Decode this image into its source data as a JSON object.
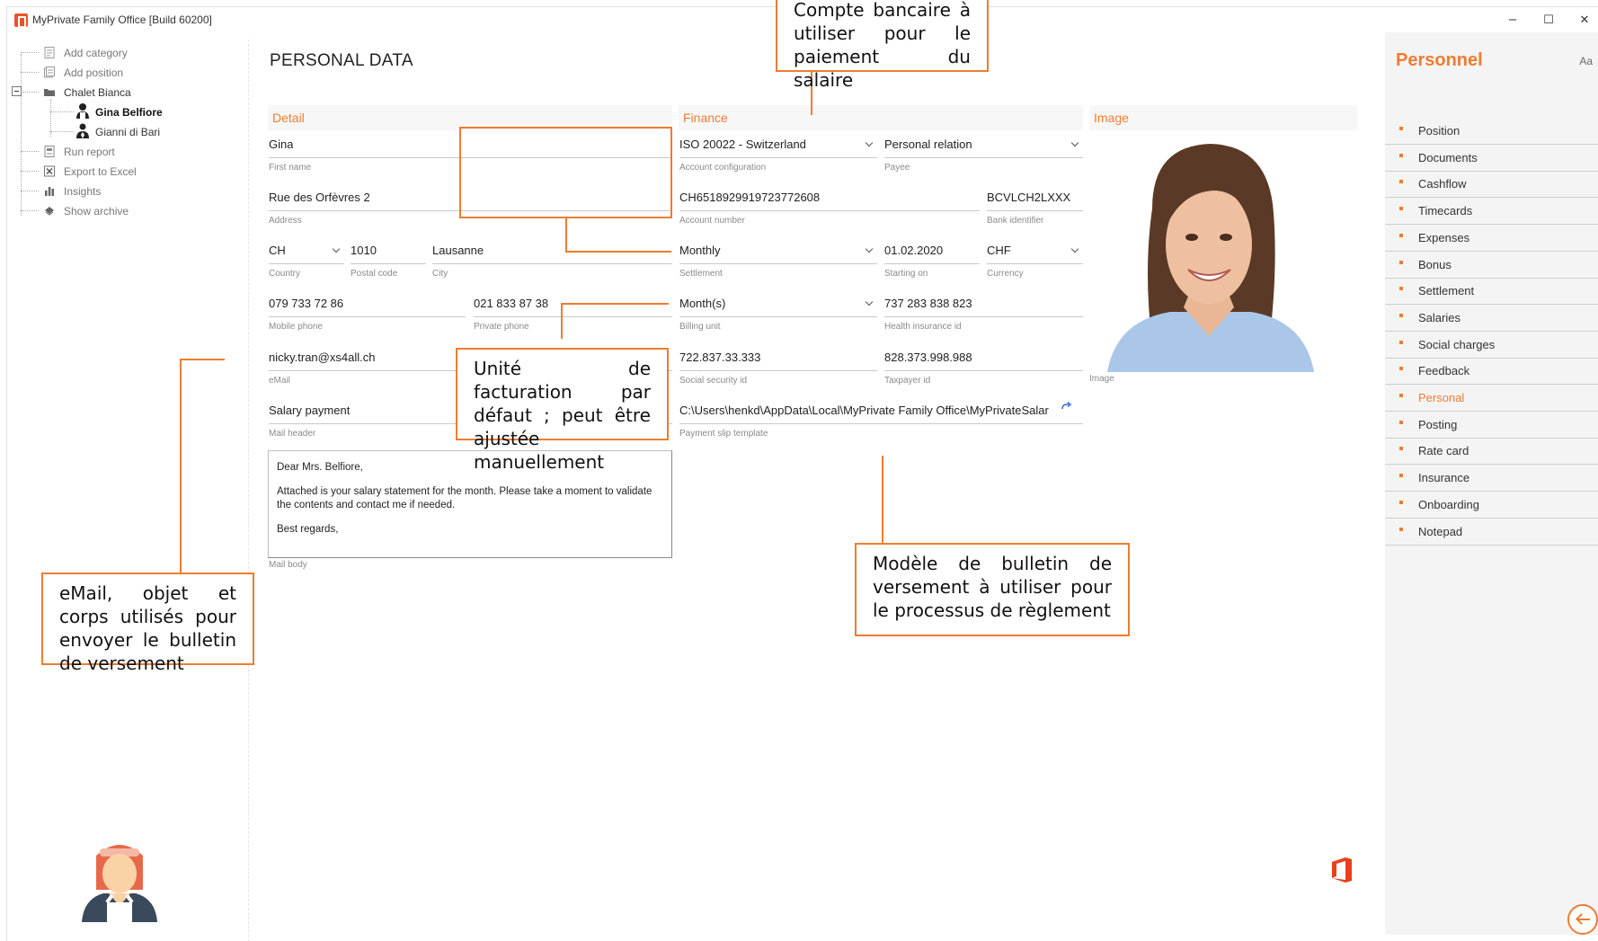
{
  "window": {
    "title": "MyPrivate Family Office [Build 60200]",
    "min_glyph": "–",
    "max_glyph": "☐",
    "close_glyph": "✕"
  },
  "tree": {
    "items": [
      {
        "label": "Add category",
        "icon": "add-category-icon"
      },
      {
        "label": "Add position",
        "icon": "add-position-icon"
      },
      {
        "label": "Chalet Bianca",
        "icon": "folder-icon"
      },
      {
        "label": "Gina Belfiore",
        "icon": "maid-person-icon"
      },
      {
        "label": "Gianni di Bari",
        "icon": "butler-person-icon"
      },
      {
        "label": "Run report",
        "icon": "report-icon"
      },
      {
        "label": "Export to Excel",
        "icon": "excel-icon"
      },
      {
        "label": "Insights",
        "icon": "bar-chart-icon"
      },
      {
        "label": "Show archive",
        "icon": "archive-icon"
      }
    ]
  },
  "page": {
    "title": "PERSONAL DATA"
  },
  "sections": {
    "detail": "Detail",
    "finance": "Finance",
    "image": "Image"
  },
  "detail": {
    "first_name": {
      "value": "Gina",
      "label": "First name"
    },
    "address": {
      "value": "Rue des Orfèvres 2",
      "label": "Address"
    },
    "country": {
      "value": "CH",
      "label": "Country"
    },
    "postal_code": {
      "value": "1010",
      "label": "Postal code"
    },
    "city": {
      "value": "Lausanne",
      "label": "City"
    },
    "mobile_phone": {
      "value": "079 733 72 86",
      "label": "Mobile phone"
    },
    "private_phone": {
      "value": "021 833 87 38",
      "label": "Private phone"
    },
    "email": {
      "value": "nicky.tran@xs4all.ch",
      "label": "eMail"
    },
    "mail_header": {
      "value": "Salary payment",
      "label": "Mail header"
    },
    "mail_body": {
      "greeting": "Dear Mrs. Belfiore,",
      "text": "Attached is your salary statement for the month. Please take a moment to validate the contents and contact me if needed.",
      "closing": "Best regards,",
      "label": "Mail body"
    }
  },
  "finance": {
    "account_configuration": {
      "value": "ISO 20022 - Switzerland",
      "label": "Account configuration"
    },
    "payee": {
      "value": "Personal relation",
      "label": "Payee"
    },
    "account_number": {
      "value": "CH6518929919723772608",
      "label": "Account number"
    },
    "bank_identifier": {
      "value": "BCVLCH2LXXX",
      "label": "Bank identifier"
    },
    "settlement": {
      "value": "Monthly",
      "label": "Settlement"
    },
    "starting_on": {
      "value": "01.02.2020",
      "label": "Starting on"
    },
    "currency": {
      "value": "CHF",
      "label": "Currency"
    },
    "billing_unit": {
      "value": "Month(s)",
      "label": "Billing unit"
    },
    "health_insurance_id": {
      "value": "737 283 838 823",
      "label": "Health insurance id"
    },
    "social_security_id": {
      "value": "722.837.33.333",
      "label": "Social security id"
    },
    "taxpayer_id": {
      "value": "828.373.998.988",
      "label": "Taxpayer id"
    },
    "payment_slip_template": {
      "value": "C:\\Users\\henkd\\AppData\\Local\\MyPrivate Family Office\\MyPrivateSalar",
      "label": "Payment slip template"
    }
  },
  "image": {
    "label": "Image"
  },
  "callouts": {
    "bank_account": "Compte bancaire à utiliser pour le paiement du salaire",
    "billing_unit": "Unité de facturation par défaut ; peut être ajustée manuellement",
    "email": "eMail, objet et corps utilisés pour envoyer le bulletin de versement",
    "template": "Modèle de bulletin de versement à utiliser pour le processus de règlement"
  },
  "right_panel": {
    "title": "Personnel",
    "font_toggle": "Aa",
    "active": "Personal",
    "items": [
      "Position",
      "Documents",
      "Cashflow",
      "Timecards",
      "Expenses",
      "Bonus",
      "Settlement",
      "Salaries",
      "Social charges",
      "Feedback",
      "Personal",
      "Posting",
      "Rate card",
      "Insurance",
      "Onboarding",
      "Notepad"
    ]
  },
  "colors": {
    "accent": "#ed7d31",
    "section_bg": "#f7f7f7",
    "panel_bg": "#f4f4f4"
  }
}
